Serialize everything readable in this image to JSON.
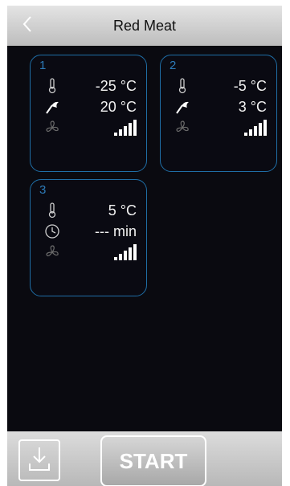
{
  "header": {
    "title": "Red Meat",
    "back_icon": "chevron-left-icon"
  },
  "cards": [
    {
      "number": "1",
      "rows": [
        {
          "icon": "thermometer-icon",
          "value": "-25 °C"
        },
        {
          "icon": "probe-icon",
          "value": "20 °C"
        },
        {
          "icon": "fan-icon",
          "fan_level": 5
        }
      ]
    },
    {
      "number": "2",
      "rows": [
        {
          "icon": "thermometer-icon",
          "value": "-5 °C"
        },
        {
          "icon": "probe-icon",
          "value": "3 °C"
        },
        {
          "icon": "fan-icon",
          "fan_level": 5
        }
      ]
    },
    {
      "number": "3",
      "rows": [
        {
          "icon": "thermometer-icon",
          "value": "5 °C"
        },
        {
          "icon": "clock-icon",
          "value": "--- min"
        },
        {
          "icon": "fan-icon",
          "fan_level": 5
        }
      ]
    }
  ],
  "footer": {
    "download_icon": "download-icon",
    "start_label": "START"
  },
  "colors": {
    "card_border": "#1f6ea6",
    "card_number": "#2d7bb8",
    "background": "#0a0a10"
  }
}
